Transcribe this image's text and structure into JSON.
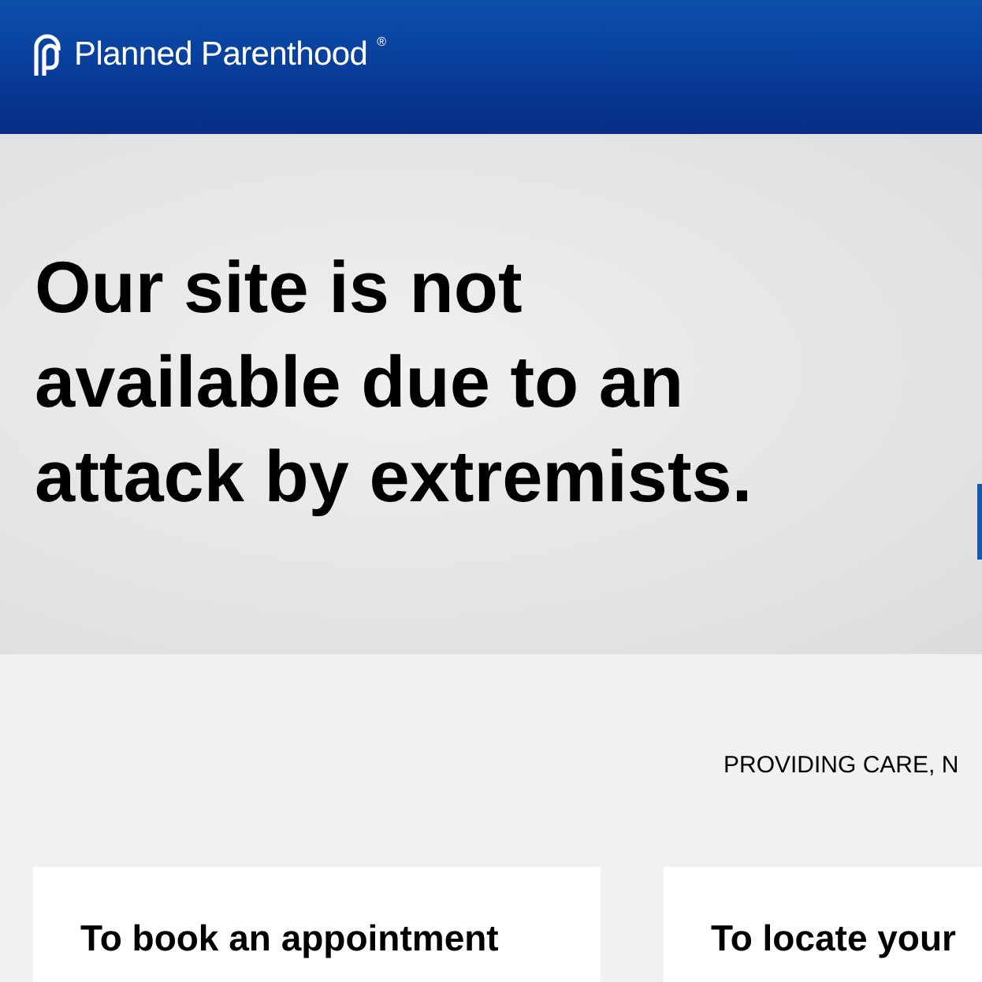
{
  "header": {
    "logo_text": "Planned Parenthood",
    "logo_mark": "®"
  },
  "hero": {
    "heading": "Our site is not available due to an attack by extremists."
  },
  "tagline": "PROVIDING CARE, N",
  "cards": [
    {
      "title": "To book an appointment"
    },
    {
      "title": "To locate your"
    }
  ]
}
